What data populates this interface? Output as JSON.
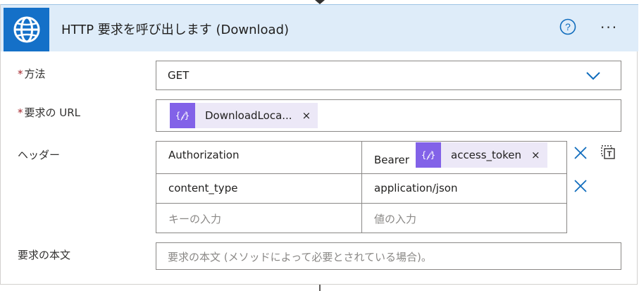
{
  "action": {
    "title": "HTTP 要求を呼び出します (Download)",
    "icon": "globe-icon",
    "help_icon": "help-circle-icon",
    "more_label": "···"
  },
  "method": {
    "label": "方法",
    "required_mark": "*",
    "value": "GET",
    "dropdown_icon": "chevron-down-icon"
  },
  "url": {
    "label": "要求の URL",
    "required_mark": "*",
    "token_label": "DownloadLoca...",
    "token_remove": "×"
  },
  "headers": {
    "label": "ヘッダー",
    "rows": [
      {
        "key": "Authorization",
        "value_prefix": "Bearer",
        "value_token": "access_token",
        "value_token_remove": "×"
      },
      {
        "key": "content_type",
        "value": "application/json"
      },
      {
        "key_placeholder": "キーの入力",
        "value_placeholder": "値の入力"
      }
    ]
  },
  "body": {
    "label": "要求の本文",
    "placeholder": "要求の本文 (メソッドによって必要とされている場合)。"
  },
  "colors": {
    "header_bg": "#deecf9",
    "icon_bg": "#1470c8",
    "token_bg": "#ece8f7",
    "token_icon_bg": "#8262e8",
    "accent": "#0f6cbd"
  }
}
